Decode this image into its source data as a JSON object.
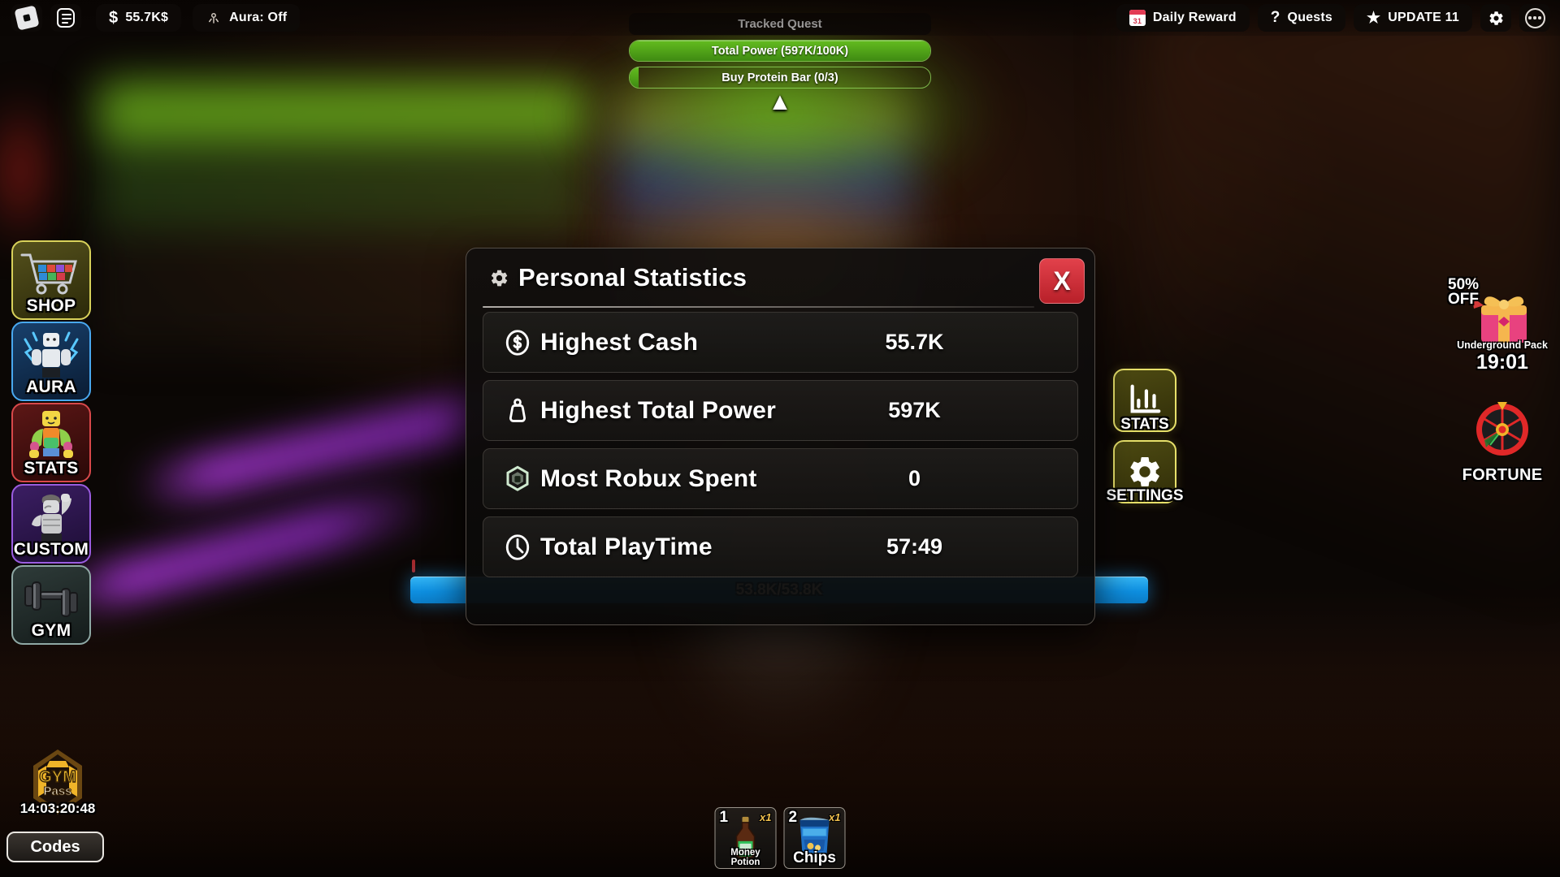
{
  "topbar": {
    "roblox_logo": "roblox-logo",
    "chat_icon": "chat-icon",
    "cash": "55.7K$",
    "cash_icon": "dollar-icon",
    "aura": "Aura: Off",
    "aura_icon": "aura-icon",
    "daily_reward": "Daily Reward",
    "daily_reward_icon": "calendar-icon",
    "quests": "Quests",
    "quests_icon": "question-mark-icon",
    "update": "UPDATE 11",
    "update_icon": "star-icon",
    "settings_icon": "gear-icon",
    "more_icon": "ellipsis-icon"
  },
  "quest_tracker": {
    "title": "Tracked Quest",
    "objectives": [
      {
        "label": "Total Power (597K/100K)",
        "progress_pct": 100
      },
      {
        "label": "Buy Protein Bar (0/3)",
        "progress_pct": 3
      }
    ],
    "collapse_arrow": "▲"
  },
  "sidebar": {
    "items": [
      {
        "label": "SHOP",
        "icon": "shopping-cart-icon",
        "border": "#d8d15a",
        "bg1": "#55511c",
        "bg2": "#2b2909"
      },
      {
        "label": "AURA",
        "icon": "aura-character-icon",
        "border": "#49a8ef",
        "bg1": "#18406c",
        "bg2": "#0a1c33"
      },
      {
        "label": "STATS",
        "icon": "muscle-character-icon",
        "border": "#d8484a",
        "bg1": "#5c1716",
        "bg2": "#2a0807"
      },
      {
        "label": "CUSTOM",
        "icon": "custom-character-icon",
        "border": "#9a5ce0",
        "bg1": "#3b1e63",
        "bg2": "#1c0d33"
      },
      {
        "label": "GYM",
        "icon": "dumbbell-icon",
        "border": "#8fa9a5",
        "bg1": "#2e3b39",
        "bg2": "#141b1a"
      }
    ]
  },
  "right_stack": {
    "items": [
      {
        "label": "STATS",
        "icon": "bar-chart-icon"
      },
      {
        "label": "SETTINGS",
        "icon": "gear-icon"
      }
    ]
  },
  "promo": {
    "discount": "50%\nOFF",
    "discount_line1": "50%",
    "discount_line2": "OFF",
    "pack_name": "Underground Pack",
    "timer": "19:01",
    "gift_icon": "gift-box-icon",
    "fortune_label": "FORTUNE",
    "fortune_icon": "fortune-wheel-icon"
  },
  "gym_pass": {
    "title_line1": "GYM",
    "title_line2": "Pass",
    "timer": "14:03:20:48",
    "icon": "gym-pass-badge-icon"
  },
  "codes_button": {
    "label": "Codes"
  },
  "xp_bar": {
    "text": "53.8K/53.8K",
    "progress_pct": 100,
    "color": "#1190e0"
  },
  "hotbar": {
    "slots": [
      {
        "key": "1",
        "count": "x1",
        "name": "Money Potion",
        "icon": "potion-bottle-icon",
        "size": "sm"
      },
      {
        "key": "2",
        "count": "x1",
        "name": "Chips",
        "icon": "chips-bag-icon",
        "size": "lg"
      }
    ]
  },
  "panel": {
    "title": "Personal Statistics",
    "title_icon": "gear-icon",
    "close_label": "X",
    "close_color": "#cc2f39",
    "rows": [
      {
        "icon": "cash-coin-icon",
        "label": "Highest Cash",
        "value": "55.7K"
      },
      {
        "icon": "power-weight-icon",
        "label": "Highest Total Power",
        "value": "597K"
      },
      {
        "icon": "robux-icon",
        "label": "Most Robux Spent",
        "value": "0"
      },
      {
        "icon": "clock-icon",
        "label": "Total PlayTime",
        "value": "57:49"
      }
    ]
  }
}
